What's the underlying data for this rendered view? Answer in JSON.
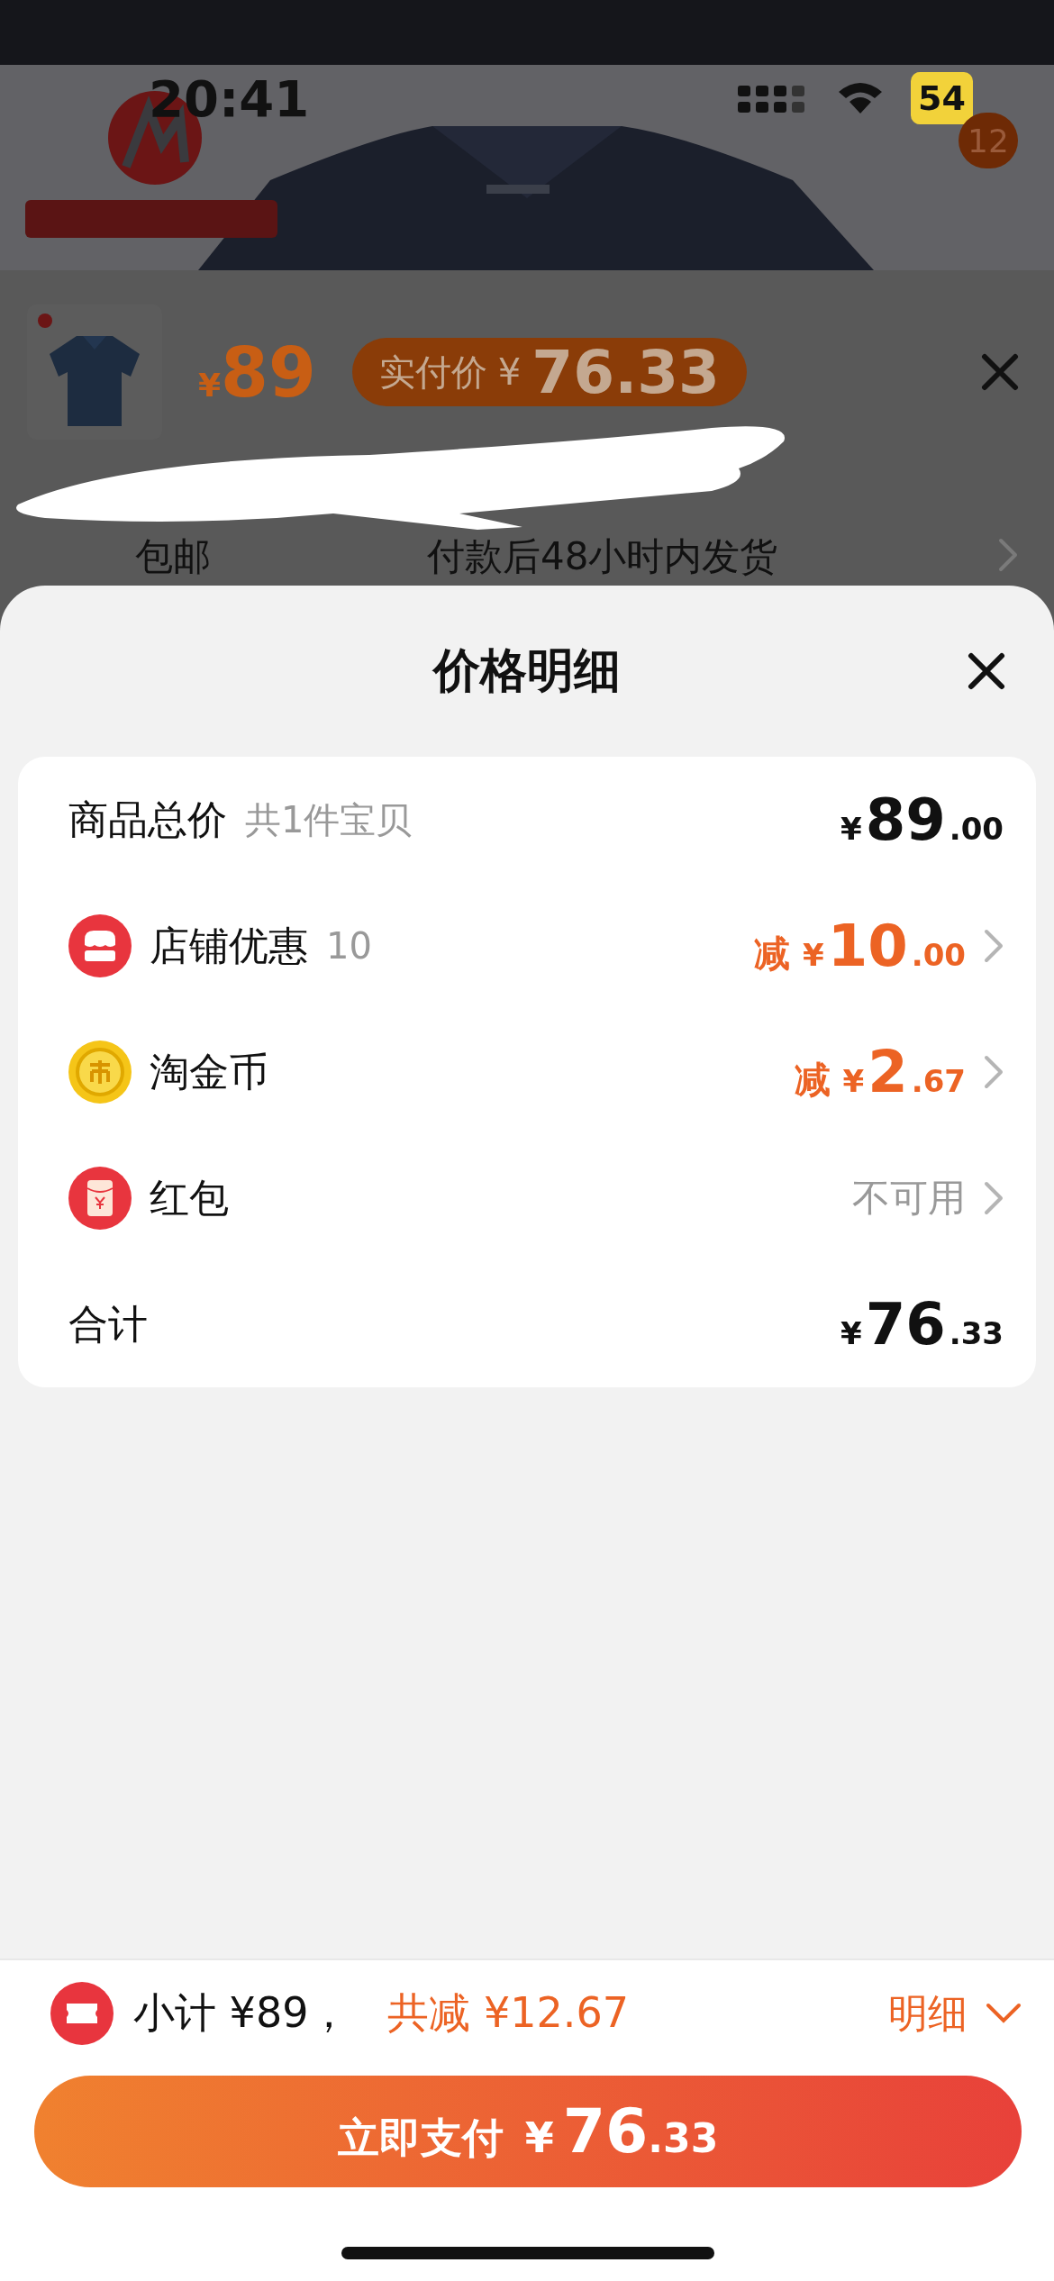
{
  "status_bar": {
    "time": "20:41",
    "battery": "54"
  },
  "header": {
    "cart_badge": "12"
  },
  "sku": {
    "symbol": "¥",
    "price": "89",
    "badge_label": "实付价",
    "badge_symbol": "¥",
    "badge_price": "76.33",
    "shipping": [
      "包邮",
      "付款后48小时内发货"
    ]
  },
  "sheet": {
    "title": "价格明细",
    "rows": [
      {
        "kind": "subtotal",
        "label": "商品总价",
        "note": "共1件宝贝",
        "prefix": "",
        "symbol": "¥",
        "integer": "89",
        "decimal": ".00",
        "chevron": false
      },
      {
        "kind": "store",
        "label": "店铺优惠",
        "note": "10",
        "prefix": "减",
        "symbol": "¥",
        "integer": "10",
        "decimal": ".00",
        "chevron": true
      },
      {
        "kind": "coin",
        "label": "淘金币",
        "note": "",
        "prefix": "减",
        "symbol": "¥",
        "integer": "2",
        "decimal": ".67",
        "chevron": true
      },
      {
        "kind": "packet",
        "label": "红包",
        "note": "",
        "text": "不可用",
        "chevron": true
      },
      {
        "kind": "total",
        "label": "合计",
        "note": "",
        "prefix": "",
        "symbol": "¥",
        "integer": "76",
        "decimal": ".33",
        "chevron": false
      }
    ]
  },
  "footer": {
    "subtotal": "小计 ¥89，",
    "saving": "共减 ¥12.67",
    "details": "明细",
    "pay_label": "立即支付",
    "pay_symbol": "¥",
    "pay_integer": "76",
    "pay_decimal": ".33"
  }
}
